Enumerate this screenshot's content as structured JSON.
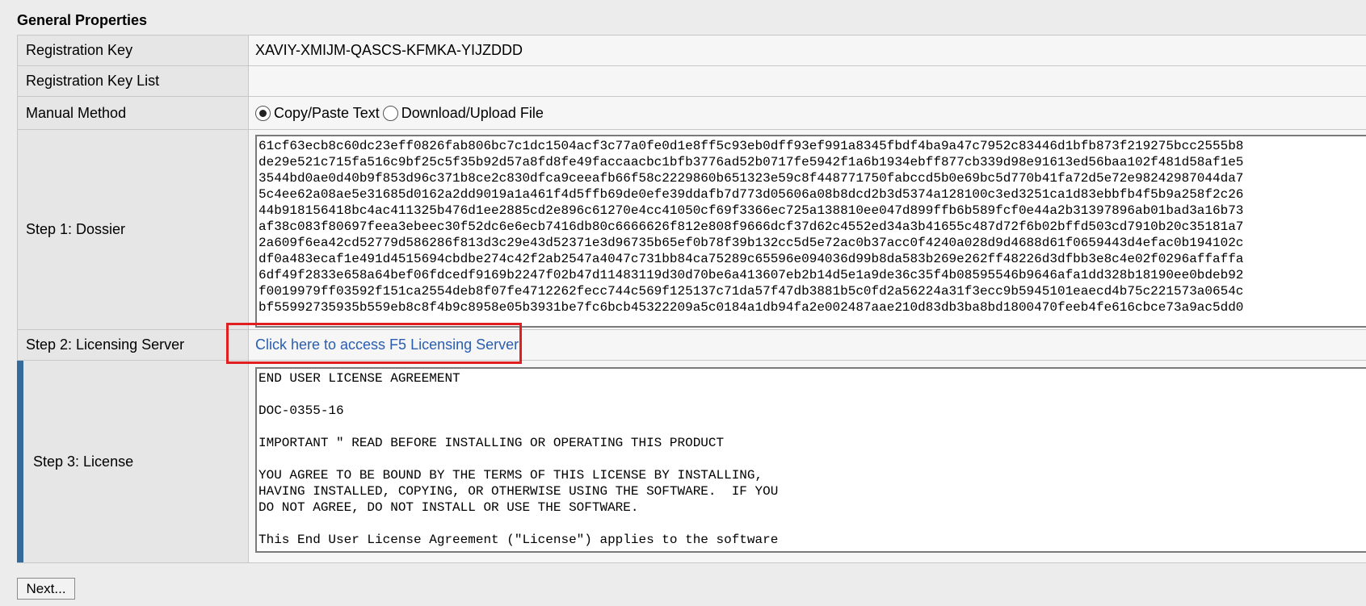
{
  "section_title": "General Properties",
  "rows": {
    "registration_key": {
      "label": "Registration Key",
      "value": "XAVIY-XMIJM-QASCS-KFMKA-YIJZDDD"
    },
    "registration_key_list": {
      "label": "Registration Key List",
      "value": ""
    },
    "manual_method": {
      "label": "Manual Method",
      "options": [
        "Copy/Paste Text",
        "Download/Upload File"
      ],
      "selected": "Copy/Paste Text"
    },
    "dossier": {
      "label": "Step 1: Dossier",
      "text": "61cf63ecb8c60dc23eff0826fab806bc7c1dc1504acf3c77a0fe0d1e8ff5c93eb0dff93ef991a8345fbdf4ba9a47c7952c83446d1bfb873f219275bcc2555b8\nde29e521c715fa516c9bf25c5f35b92d57a8fd8fe49faccaacbc1bfb3776ad52b0717fe5942f1a6b1934ebff877cb339d98e91613ed56baa102f481d58af1e5\n3544bd0ae0d40b9f853d96c371b8ce2c830dfca9ceeafb66f58c2229860b651323e59c8f448771750fabccd5b0e69bc5d770b41fa72d5e72e98242987044da7\n5c4ee62a08ae5e31685d0162a2dd9019a1a461f4d5ffb69de0efe39ddafb7d773d05606a08b8dcd2b3d5374a128100c3ed3251ca1d83ebbfb4f5b9a258f2c26\n44b918156418bc4ac411325b476d1ee2885cd2e896c61270e4cc41050cf69f3366ec725a138810ee047d899ffb6b589fcf0e44a2b31397896ab01bad3a16b73\naf38c083f80697feea3ebeec30f52dc6e6ecb7416db80c6666626f812e808f9666dcf37d62c4552ed34a3b41655c487d72f6b02bffd503cd7910b20c35181a7\n2a609f6ea42cd52779d586286f813d3c29e43d52371e3d96735b65ef0b78f39b132cc5d5e72ac0b37acc0f4240a028d9d4688d61f0659443d4efac0b194102c\ndf0a483ecaf1e491d4515694cbdbe274c42f2ab2547a4047c731bb84ca75289c65596e094036d99b8da583b269e262ff48226d3dfbb3e8c4e02f0296affaffa\n6df49f2833e658a64bef06fdcedf9169b2247f02b47d11483119d30d70be6a413607eb2b14d5e1a9de36c35f4b08595546b9646afa1dd328b18190ee0bdeb92\nf0019979ff03592f151ca2554deb8f07fe4712262fecc744c569f125137c71da57f47db3881b5c0fd2a56224a31f3ecc9b5945101eaecd4b75c221573a0654c\nbf55992735935b559eb8c8f4b9c8958e05b3931be7fc6bcb45322209a5c0184a1db94fa2e002487aae210d83db3ba8bd1800470feeb4fe616cbce73a9ac5dd0"
    },
    "licensing_server": {
      "label": "Step 2: Licensing Server",
      "link_text": "Click here to access F5 Licensing Server"
    },
    "license": {
      "label": "Step 3: License",
      "text": "END USER LICENSE AGREEMENT\n\nDOC-0355-16\n\nIMPORTANT \" READ BEFORE INSTALLING OR OPERATING THIS PRODUCT\n\nYOU AGREE TO BE BOUND BY THE TERMS OF THIS LICENSE BY INSTALLING,\nHAVING INSTALLED, COPYING, OR OTHERWISE USING THE SOFTWARE.  IF YOU\nDO NOT AGREE, DO NOT INSTALL OR USE THE SOFTWARE.\n\nThis End User License Agreement (\"License\") applies to the software"
    }
  },
  "buttons": {
    "next_label": "Next..."
  },
  "colors": {
    "link": "#2a5db0",
    "highlight_box": "#e02020",
    "active_row_accent": "#356a9e"
  }
}
